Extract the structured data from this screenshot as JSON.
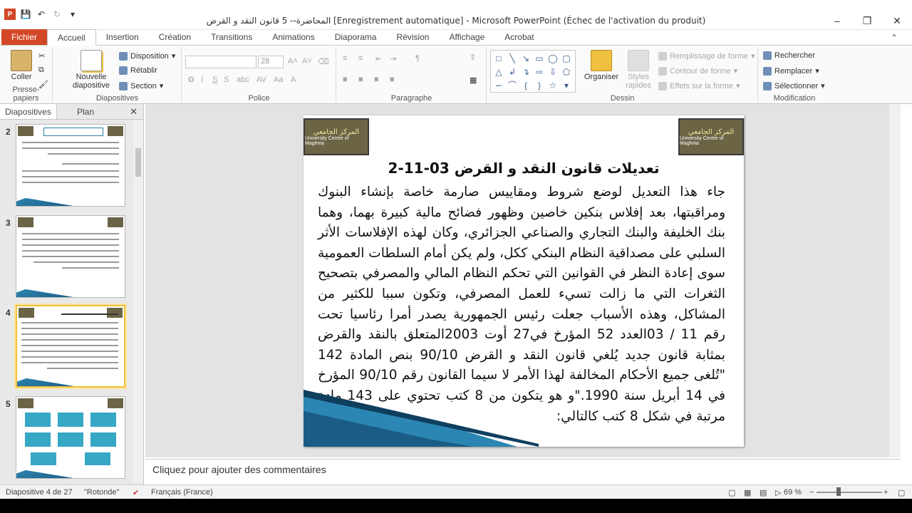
{
  "window": {
    "title": "المحاضرة-- 5 قانون النقد و القرض [Enregistrement automatique]  -  Microsoft PowerPoint (Échec de l'activation du produit)"
  },
  "ribbon_tabs": [
    "Fichier",
    "Accueil",
    "Insertion",
    "Création",
    "Transitions",
    "Animations",
    "Diaporama",
    "Révision",
    "Affichage",
    "Acrobat"
  ],
  "ribbon": {
    "clipboard": {
      "paste": "Coller",
      "group": "Presse-papiers"
    },
    "slides": {
      "new_slide": "Nouvelle diapositive",
      "layout": "Disposition",
      "reset": "Rétablir",
      "section": "Section",
      "group": "Diapositives"
    },
    "font": {
      "size": "28",
      "group": "Police"
    },
    "paragraph": {
      "group": "Paragraphe"
    },
    "drawing": {
      "arrange": "Organiser",
      "quick_styles": "Styles rapides",
      "fill": "Remplissage de forme",
      "outline": "Contour de forme",
      "effects": "Effets sur la forme",
      "group": "Dessin"
    },
    "editing": {
      "find": "Rechercher",
      "replace": "Remplacer",
      "select": "Sélectionner",
      "group": "Modification"
    }
  },
  "panel": {
    "tab_slides": "Diapositives",
    "tab_outline": "Plan"
  },
  "thumbnails": [
    {
      "num": "2"
    },
    {
      "num": "3"
    },
    {
      "num": "4"
    },
    {
      "num": "5"
    }
  ],
  "slide": {
    "logo_ar": "المركز الجامعي",
    "logo_en": "University Centre of Maghnia",
    "title": "2-تعديلات قانون النقد و القرض 03-11",
    "body": "جاء هذا التعديل لوضع شروط ومقاييس صارمة خاصة بإنشاء البنوك ومراقبتها، بعد إفلاس بنكين خاصين وظهور فضائح مالية كبيرة بهما، وهما بنك الخليفة والبنك التجاري والصناعي الجزائري، وكان لهذه الإفلاسات الأثر السلبي على مصداقية النظام البنكي ككل، ولم يكن أمام السلطات العمومية سوى إعادة النظر في القوانين التي تحكم النظام المالي والمصرفي بتصحيح الثغرات التي ما زالت تسيء للعمل المصرفي، وتكون سببا للكثير من المشاكل، وهذه الأسباب جعلت رئيس الجمهورية يصدر أمرا رئاسيا تحت رقم  11 / 03العدد 52 المؤرخ في27 أوت  2003المتعلق بالنقد والقرض بمثابة قانون جديد يُلغي قانون النقد و القرض 90/10 بنص المادة 142 \"تُلغى جميع الأحكام المخالفة لهذا الأمر لا سيما القانون رقم 90/10 المؤرخ في 14 أبريل سنة 1990.\"و هو يتكون من 8 كتب تحتوي على 143 مادة مرتبة في شكل 8 كتب كالتالي:"
  },
  "notes": {
    "placeholder": "Cliquez pour ajouter des commentaires"
  },
  "status": {
    "slide": "Diapositive 4 de 27",
    "theme": "\"Rotonde\"",
    "language": "Français (France)",
    "zoom": "69 %"
  }
}
